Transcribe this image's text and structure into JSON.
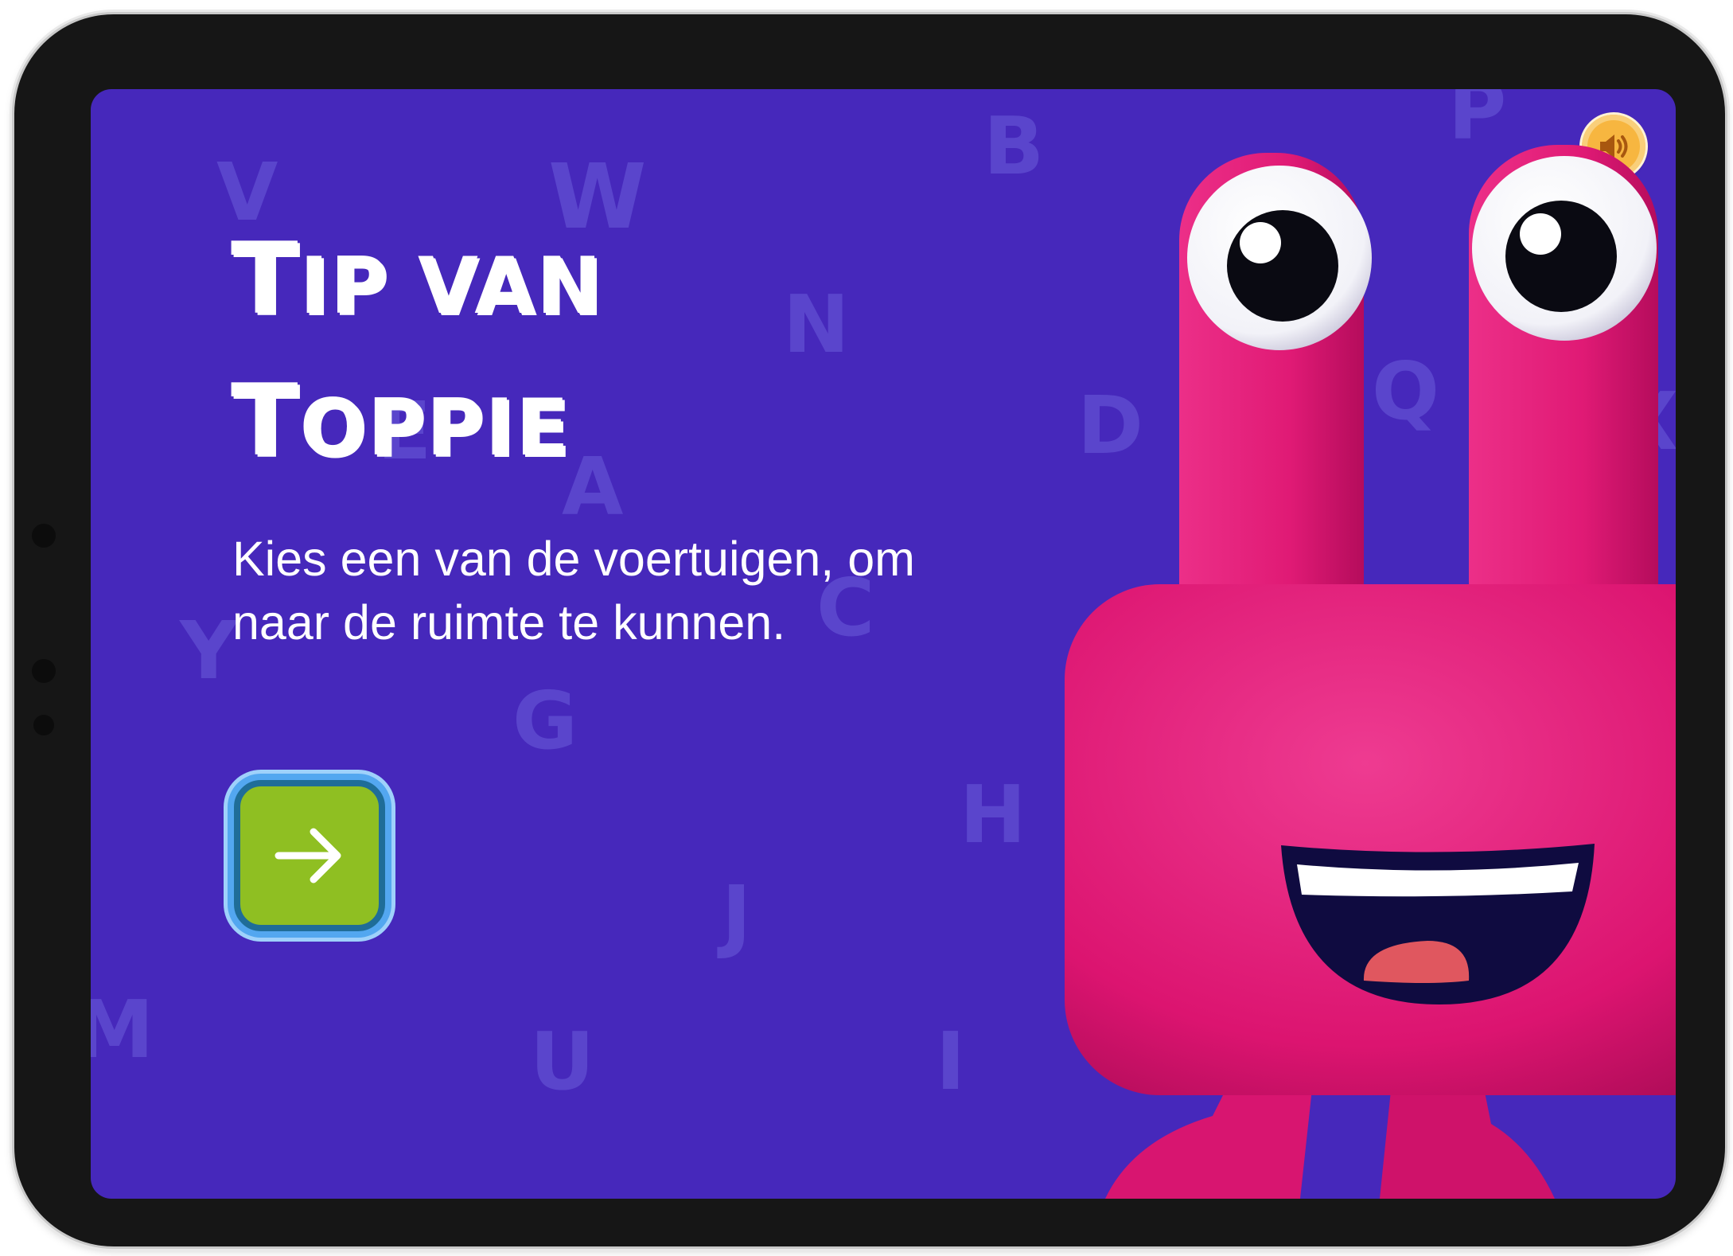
{
  "screen": {
    "title_line1": {
      "first_letter": "T",
      "rest": "IP VAN"
    },
    "title_line2": {
      "first_letter": "T",
      "rest": "OPPIE"
    },
    "description": "Kies een van de voertuigen, om naar de ruimte te kunnen.",
    "next_button": {
      "icon": "arrow-right-icon"
    },
    "sound_button": {
      "icon": "speaker-icon"
    },
    "background_letters": [
      "V",
      "W",
      "B",
      "P",
      "N",
      "E",
      "A",
      "D",
      "Q",
      "X",
      "C",
      "Y",
      "G",
      "H",
      "J",
      "M",
      "U",
      "I"
    ]
  },
  "colors": {
    "background": "#4628bb",
    "background_letters": "#5a45cc",
    "text": "#ffffff",
    "next_button": "#8fbf22",
    "next_button_border": "#53a7f0",
    "sound_button": "#f7b640",
    "monster_body": "#e3166f"
  }
}
